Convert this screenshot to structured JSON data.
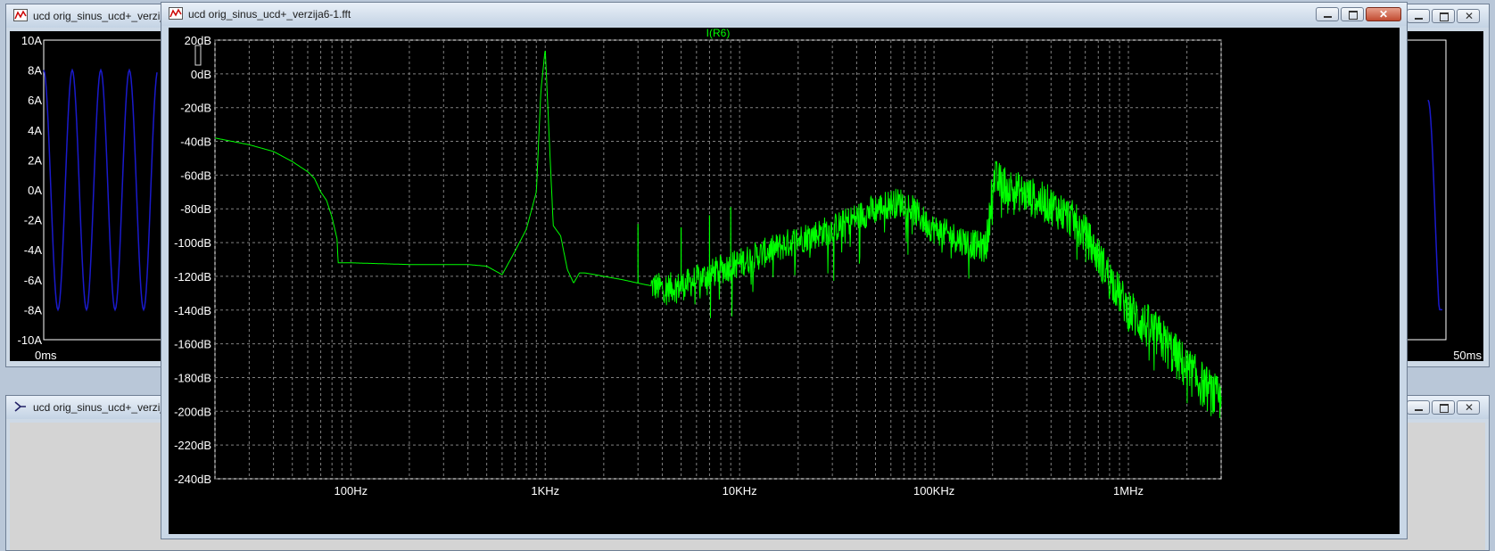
{
  "windows": {
    "back_top_left": {
      "title": "ucd orig_sinus_ucd+_verzija"
    },
    "back_bottom_left": {
      "title": "ucd orig_sinus_ucd+_verzija"
    },
    "fft": {
      "title": "ucd orig_sinus_ucd+_verzija6-1.fft"
    }
  },
  "time_plot": {
    "y_ticks": [
      "10A",
      "8A",
      "6A",
      "4A",
      "2A",
      "0A",
      "-2A",
      "-4A",
      "-6A",
      "-8A",
      "-10A"
    ],
    "x_start": "0ms",
    "x_end": "50ms",
    "trace_color": "#1a1acc"
  },
  "chart_data": {
    "type": "line",
    "title": "I(R6)",
    "xlabel": "",
    "ylabel": "",
    "x_scale": "log",
    "xlim": [
      20,
      3000000
    ],
    "ylim": [
      -240,
      20
    ],
    "grid": true,
    "y_ticks": [
      "20dB",
      "0dB",
      "-20dB",
      "-40dB",
      "-60dB",
      "-80dB",
      "-100dB",
      "-120dB",
      "-140dB",
      "-160dB",
      "-180dB",
      "-200dB",
      "-220dB",
      "-240dB"
    ],
    "x_ticks": [
      "100Hz",
      "1KHz",
      "10KHz",
      "100KHz",
      "1MHz"
    ],
    "series": [
      {
        "name": "I(R6)",
        "color": "#00ff00",
        "x": [
          20,
          30,
          40,
          50,
          60,
          65,
          70,
          75,
          80,
          85,
          86,
          90,
          100,
          200,
          300,
          400,
          500,
          600,
          700,
          800,
          900,
          950,
          1000,
          1050,
          1100,
          1200,
          1300,
          1400,
          1500,
          1600,
          1800,
          2000,
          2500,
          3000,
          4000,
          5000,
          6000,
          8000,
          10000,
          15000,
          20000,
          30000,
          40000,
          50000,
          60000,
          70000,
          80000,
          90000,
          100000,
          150000,
          180000,
          190000,
          200000,
          250000,
          300000,
          400000,
          500000,
          600000,
          800000,
          1000000,
          1500000,
          2000000,
          3000000
        ],
        "y": [
          -38,
          -42,
          -46,
          -52,
          -58,
          -62,
          -70,
          -75,
          -85,
          -98,
          -112,
          -112,
          -112,
          -113,
          -113,
          -113,
          -114,
          -119,
          -105,
          -92,
          -70,
          -10,
          15,
          -40,
          -90,
          -96,
          -116,
          -124,
          -118,
          -118,
          -119,
          -120,
          -122,
          -124,
          -127,
          -126,
          -122,
          -116,
          -112,
          -104,
          -98,
          -92,
          -85,
          -80,
          -77,
          -76,
          -82,
          -88,
          -92,
          -100,
          -103,
          -96,
          -62,
          -68,
          -72,
          -78,
          -85,
          -95,
          -120,
          -140,
          -158,
          -175,
          -195
        ]
      }
    ]
  }
}
